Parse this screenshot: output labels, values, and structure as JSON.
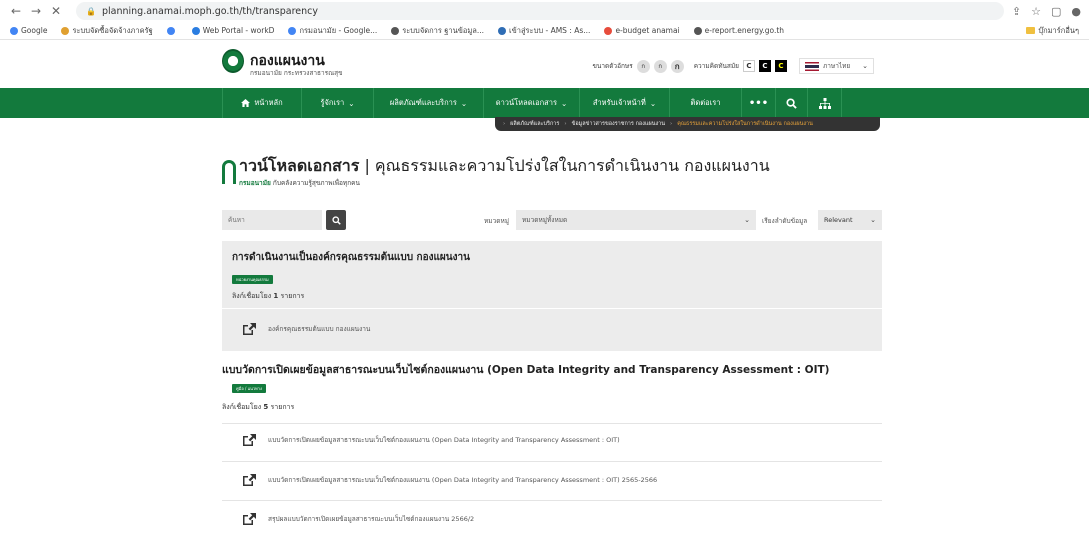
{
  "browser": {
    "url": "planning.anamai.moph.go.th/th/transparency",
    "bookmarks": [
      {
        "label": "Google",
        "color": "#4285f4"
      },
      {
        "label": "ระบบจัดซื้อจัดจ้างภาครัฐ",
        "color": "#e0a030"
      },
      {
        "label": "",
        "color": "#4285f4"
      },
      {
        "label": "Web Portal - workD",
        "color": "#2a7de1"
      },
      {
        "label": "กรมอนามัย - Google...",
        "color": "#4285f4"
      },
      {
        "label": "ระบบจัดการ ฐานข้อมูล...",
        "color": "#555"
      },
      {
        "label": "เข้าสู่ระบบ - AMS : As...",
        "color": "#2f6db5"
      },
      {
        "label": "e-budget anamai",
        "color": "#e74c3c"
      },
      {
        "label": "e-report.energy.go.th",
        "color": "#555"
      }
    ],
    "bookmarks_right": "บุ๊กมาร์กอื่นๆ"
  },
  "header": {
    "site_title": "กองแผนงาน",
    "site_subtitle": "กรมอนามัย กระทรวงสาธารณสุข",
    "font_size_label": "ขนาดตัวอักษร",
    "font_sizes": [
      "ก",
      "ก",
      "ก"
    ],
    "contrast_label": "ความคิดทันสมัย",
    "contrast_options": [
      "C",
      "C",
      "C"
    ],
    "language": "ภาษาไทย"
  },
  "nav": {
    "items": [
      "หน้าหลัก",
      "รู้จักเรา",
      "ผลิตภัณฑ์และบริการ",
      "ดาวน์โหลดเอกสาร",
      "สำหรับเจ้าหน้าที่",
      "ติดต่อเรา"
    ]
  },
  "breadcrumb": {
    "items": [
      "ผลิตภัณฑ์และบริการ",
      "ข้อมูลข่าวสารของราชการ กองแผนงาน"
    ],
    "current": "คุณธรรมและความโปร่งใสในการดำเนินงาน กองแผนงาน"
  },
  "page": {
    "title_bold": "าวน์โหลดเอกสาร",
    "title_rest": " | คุณธรรมและความโปร่งใสในการดำเนินงาน กองแผนงาน",
    "subtitle_brand": "กรมอนามัย",
    "subtitle_rest": " กับคลังความรู้สุขภาพเพื่อทุกคน"
  },
  "filters": {
    "search_placeholder": "ค้นหา",
    "category_label": "หมวดหมู่",
    "category_value": "หมวดหมู่ทั้งหมด",
    "sort_label": "เรียงลำดับข้อมูล",
    "sort_value": "Relevant"
  },
  "sections": [
    {
      "title": "การดำเนินงานเป็นองค์กรคุณธรรมต้นแบบ กองแผนงาน",
      "tag": "หน่วยงานคุณธรรม",
      "count_prefix": "ลิงก์เชื่อมโยง ",
      "count": "1",
      "count_suffix": " รายการ",
      "items": [
        "องค์กรคุณธรรมต้นแบบ กองแผนงาน"
      ]
    },
    {
      "title": "แบบวัดการเปิดเผยข้อมูลสาธารณะบนเว็บไซต์กองแผนงาน (Open Data Integrity and Transparency Assessment : OIT)",
      "tag": "คู่มือ / แนวทาง",
      "count_prefix": "ลิงก์เชื่อมโยง ",
      "count": "5",
      "count_suffix": " รายการ",
      "items": [
        "แบบวัดการเปิดเผยข้อมูลสาธารณะบนเว็บไซต์กองแผนงาน (Open Data Integrity and Transparency Assessment : OIT)",
        "แบบวัดการเปิดเผยข้อมูลสาธารณะบนเว็บไซต์กองแผนงาน (Open Data Integrity and Transparency Assessment : OIT) 2565-2566",
        "สรุปผลแบบวัดการเปิดเผยข้อมูลสาธารณะบนเว็บไซต์กองแผนงาน 2566/2"
      ]
    }
  ],
  "colors": {
    "brand_green": "#137a3d",
    "breadcrumb_bg": "#333333",
    "breadcrumb_current": "#e8a33a"
  }
}
